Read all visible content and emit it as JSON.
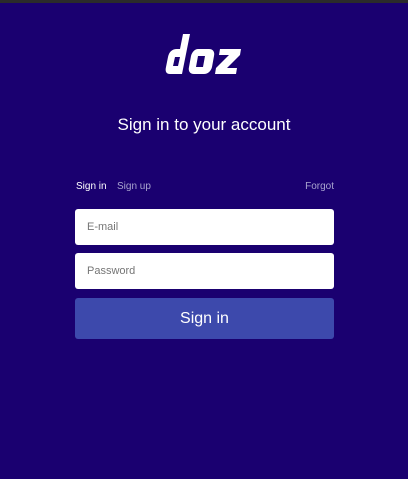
{
  "brand": {
    "name": "doz",
    "color": "#ffffff"
  },
  "heading": "Sign in to your account",
  "tabs": [
    {
      "label": "Sign in",
      "active": true
    },
    {
      "label": "Sign up",
      "active": false
    }
  ],
  "forgot_label": "Forgot",
  "form": {
    "email_placeholder": "E-mail",
    "email_value": "",
    "password_placeholder": "Password",
    "password_value": "",
    "submit_label": "Sign in"
  },
  "colors": {
    "background": "#1a0070",
    "button": "#3d49ac",
    "muted_text": "#a9a4cf"
  }
}
